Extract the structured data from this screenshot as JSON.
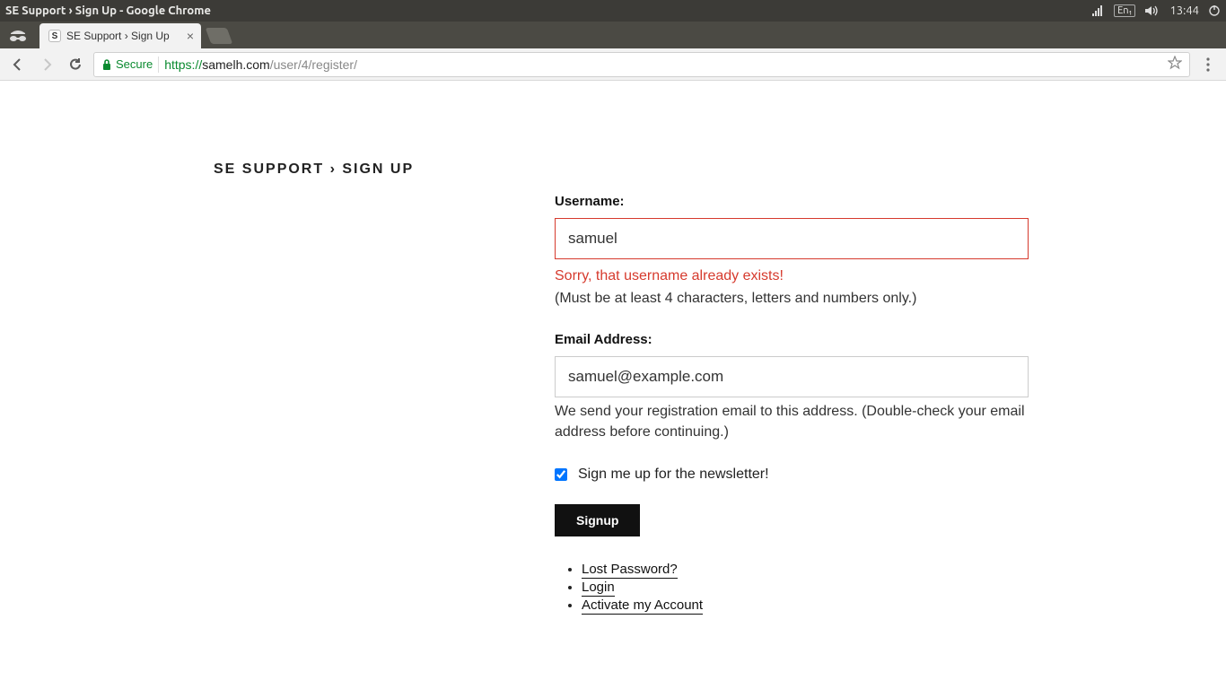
{
  "panel": {
    "window_title": "SE Support › Sign Up - Google Chrome",
    "lang_indicator": "En₁",
    "clock": "13:44"
  },
  "chrome": {
    "tab_title": "SE Support › Sign Up",
    "tab_favicon_letter": "S",
    "secure_label": "Secure",
    "url_scheme": "https://",
    "url_host": "samelh.com",
    "url_path": "/user/4/register/"
  },
  "page": {
    "heading": "SE SUPPORT › SIGN UP",
    "username_label": "Username:",
    "username_value": "samuel",
    "username_error": "Sorry, that username already exists!",
    "username_hint": "(Must be at least 4 characters, letters and numbers only.)",
    "email_label": "Email Address:",
    "email_value": "samuel@example.com",
    "email_hint": "We send your registration email to this address. (Double-check your email address before continuing.)",
    "newsletter_label": "Sign me up for the newsletter!",
    "newsletter_checked": true,
    "submit_label": "Signup",
    "links": {
      "lost_password": "Lost Password?",
      "login": "Login",
      "activate": "Activate my Account"
    }
  }
}
